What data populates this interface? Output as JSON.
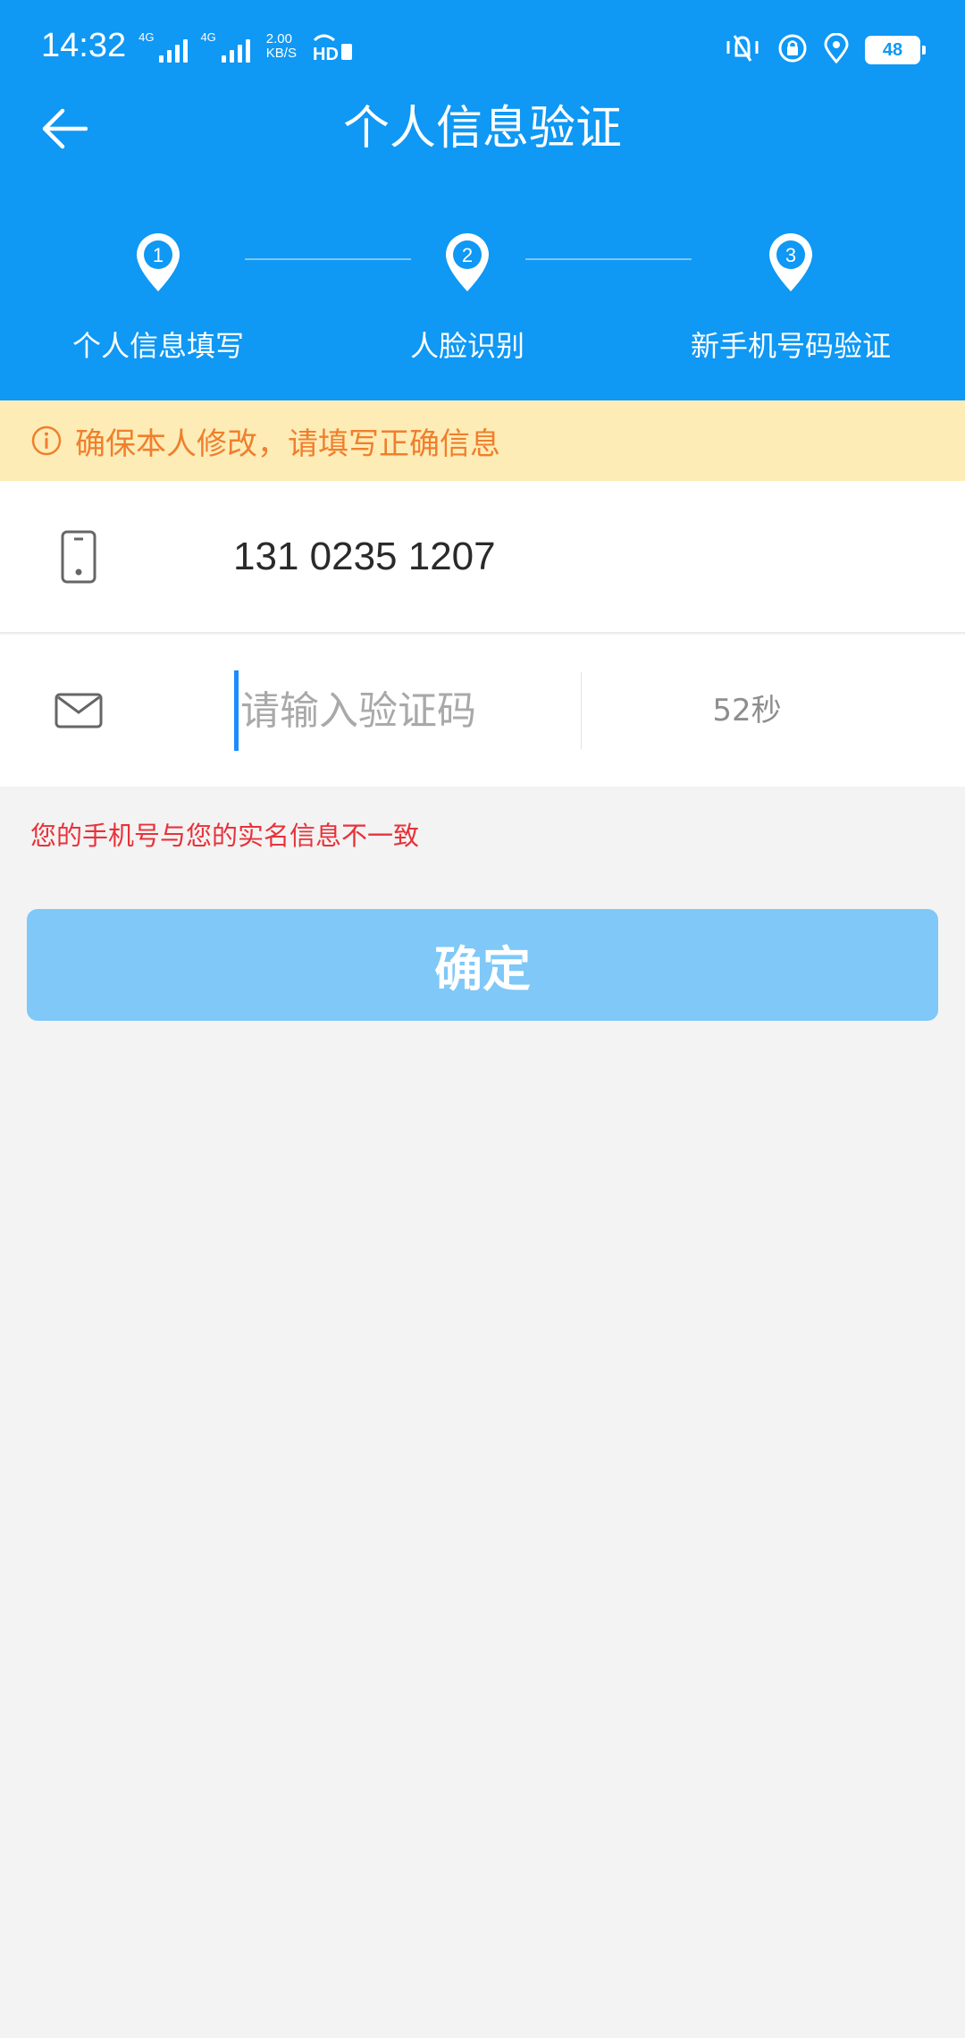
{
  "status_bar": {
    "time": "14:32",
    "network_1": "4G",
    "network_2": "4G",
    "speed_value": "2.00",
    "speed_unit": "KB/S",
    "battery": "48"
  },
  "header": {
    "title": "个人信息验证",
    "back_icon": "arrow-left-icon"
  },
  "steps": [
    {
      "number": "1",
      "label": "个人信息填写"
    },
    {
      "number": "2",
      "label": "人脸识别"
    },
    {
      "number": "3",
      "label": "新手机号码验证"
    }
  ],
  "notice": {
    "text": "确保本人修改，请填写正确信息",
    "icon": "info-icon"
  },
  "form": {
    "phone_icon": "phone-icon",
    "phone_value": "131 0235 1207",
    "code_icon": "mail-icon",
    "code_placeholder": "请输入验证码",
    "code_value": "",
    "countdown": "52秒"
  },
  "error_text": "您的手机号与您的实名信息不一致",
  "confirm_label": "确定",
  "colors": {
    "primary": "#0f98f4",
    "notice_bg": "#fdecb6",
    "notice_text": "#f07f2d",
    "error": "#e8323a",
    "button_disabled": "#7fc8f8"
  }
}
